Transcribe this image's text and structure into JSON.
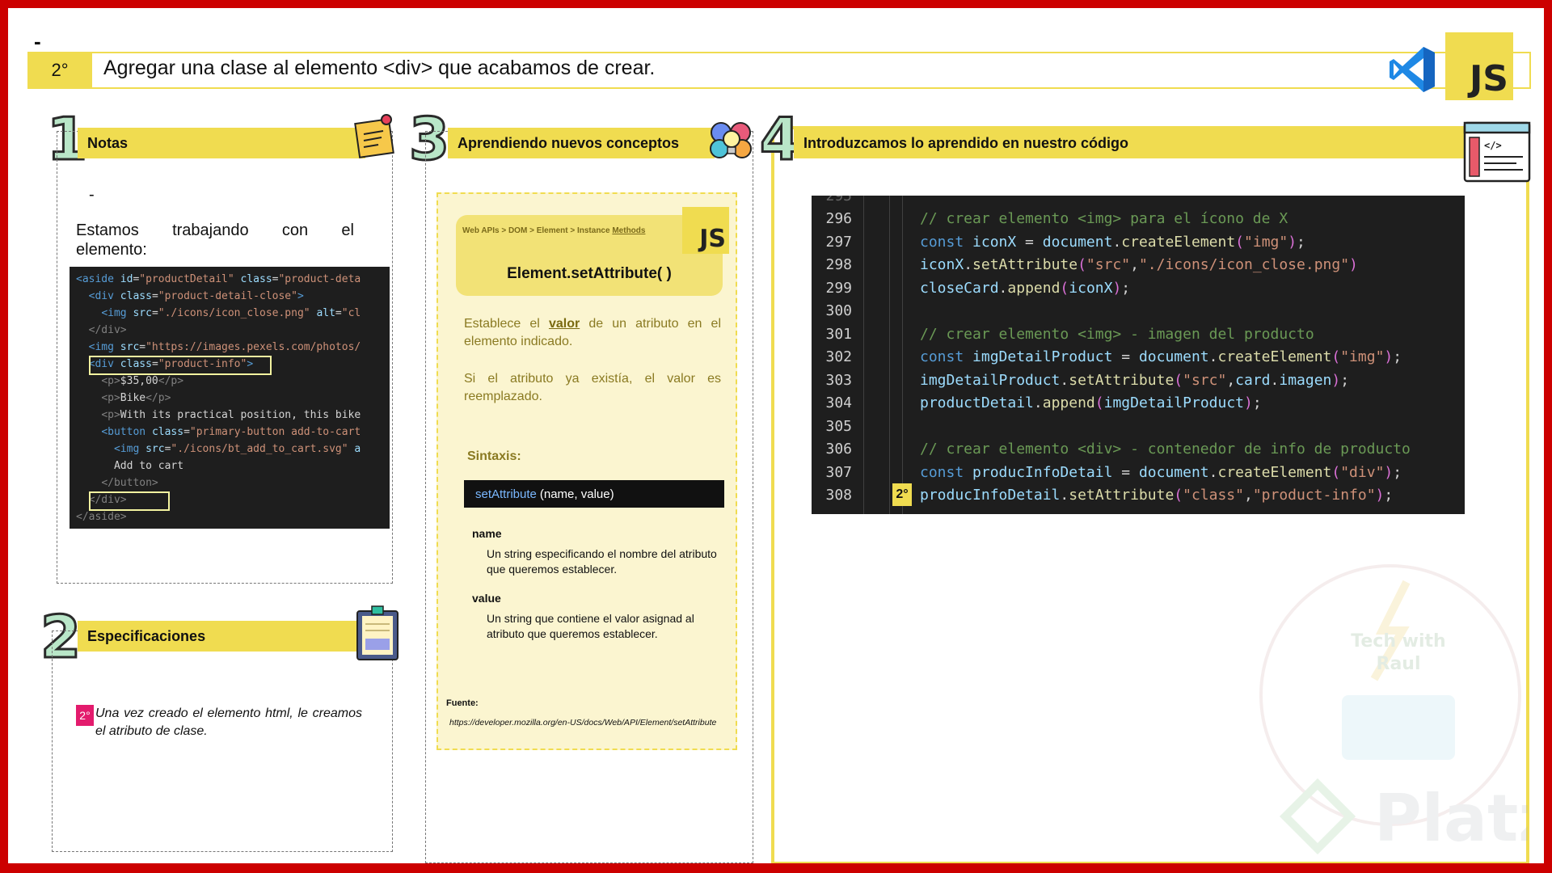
{
  "page": {
    "dash": "-",
    "step_number": "2°",
    "step_title": "Agregar una clase al elemento <div> que acabamos de crear.",
    "js_badge": "JS"
  },
  "sections": {
    "notes": {
      "number": "1",
      "title": "Notas",
      "bullet": "-",
      "text_line1": "Estamos trabajando con el",
      "text_line2": "elemento:",
      "code_lines": [
        "<aside id=\"productDetail\" class=\"product-deta",
        "  <div class=\"product-detail-close\">",
        "    <img src=\"./icons/icon_close.png\" alt=\"cl",
        "  </div>",
        "  <img src=\"https://images.pexels.com/photos/",
        "  <div class=\"product-info\">",
        "    <p>$35,00</p>",
        "    <p>Bike</p>",
        "    <p>With its practical position, this bike",
        "    <button class=\"primary-button add-to-cart",
        "      <img src=\"./icons/bt_add_to_cart.svg\" a",
        "      Add to cart",
        "    </button>",
        "  </div>",
        "</aside>"
      ]
    },
    "specs": {
      "number": "2",
      "title": "Especificaciones",
      "badge": "2°",
      "note": "Una vez creado el elemento html, le creamos el atributo de clase."
    },
    "concepts": {
      "number": "3",
      "title": "Aprendiendo nuevos conceptos",
      "breadcrumb_prefix": "Web APIs > DOM > Element > Instance ",
      "breadcrumb_link": "Methods",
      "js_badge": "JS",
      "method_title": "Element.setAttribute( )",
      "desc1_pre": "Establece el ",
      "desc1_bold": "valor",
      "desc1_post": " de un atributo en el elemento indicado.",
      "desc2": "Si el atributo ya existía, el valor es reemplazado.",
      "syntax_label": "Sintaxis:",
      "syntax_method": "setAttribute",
      "syntax_args": "(name, value)",
      "param1_name": "name",
      "param1_desc": "Un string especificando el nombre del atributo que queremos establecer.",
      "param2_name": "value",
      "param2_desc": "Un string que contiene el valor asignad al atributo que queremos establecer.",
      "source_label": "Fuente:",
      "source_url": "https://developer.mozilla.org/en-US/docs/Web/API/Element/setAttribute"
    },
    "apply": {
      "number": "4",
      "title": "Introduzcamos lo aprendido en nuestro código",
      "line_numbers": [
        "296",
        "297",
        "298",
        "299",
        "300",
        "301",
        "302",
        "303",
        "304",
        "305",
        "306",
        "307",
        "308"
      ],
      "code_lines": [
        "// crear elemento <img> para el ícono de X",
        "const iconX = document.createElement(\"img\");",
        "iconX.setAttribute(\"src\",\"./icons/icon_close.png\")",
        "closeCard.append(iconX);",
        "",
        "// crear elemento <img> - imagen del producto",
        "const imgDetailProduct = document.createElement(\"img\");",
        "imgDetailProduct.setAttribute(\"src\",card.imagen);",
        "productDetail.append(imgDetailProduct);",
        "",
        "// crear elemento <div> - contenedor de info de producto",
        "const producInfoDetail = document.createElement(\"div\");",
        "producInfoDetail.setAttribute(\"class\",\"product-info\");"
      ],
      "line_badge": "2°"
    }
  },
  "watermark": {
    "brand": "Platzi",
    "line1": "Tech with",
    "line2": "Raul"
  },
  "colors": {
    "frame_red": "#cc0000",
    "accent_yellow": "#f0dc50",
    "badge_pink": "#e31b6d"
  }
}
